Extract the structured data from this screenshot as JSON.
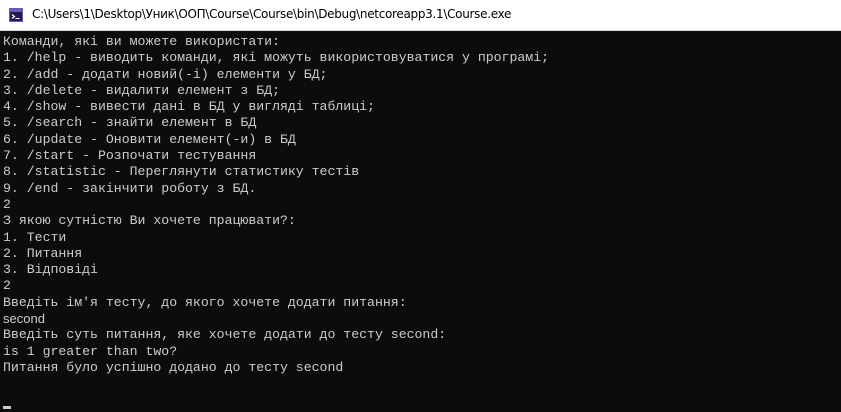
{
  "window": {
    "title": "C:\\Users\\1\\Desktop\\Уник\\ООП\\Course\\Course\\bin\\Debug\\netcoreapp3.1\\Course.exe",
    "icon": "console-app-icon",
    "background_color": "#0c0c0c",
    "text_color": "#cccccc"
  },
  "console": {
    "lines": [
      {
        "text": "Команди, які ви можете використати:",
        "font": "mono"
      },
      {
        "text": "1. /help - виводить команди, які можуть використовуватися у програмі;",
        "font": "mono"
      },
      {
        "text": "2. /add - додати новий(-і) елементи у БД;",
        "font": "mono"
      },
      {
        "text": "3. /delete - видалити елемент з БД;",
        "font": "mono"
      },
      {
        "text": "4. /show - вивести дані в БД у вигляді таблиці;",
        "font": "mono"
      },
      {
        "text": "5. /search - знайти елемент в БД",
        "font": "mono"
      },
      {
        "text": "6. /update - Оновити елемент(-и) в БД",
        "font": "mono"
      },
      {
        "text": "7. /start - Розпочати тестування",
        "font": "mono"
      },
      {
        "text": "8. /statistic - Переглянути статистику тестів",
        "font": "mono"
      },
      {
        "text": "9. /end - закінчити роботу з БД.",
        "font": "mono"
      },
      {
        "text": "2",
        "font": "mono"
      },
      {
        "text": "З якою сутністю Ви хочете працювати?:",
        "font": "mono"
      },
      {
        "text": "1. Тести",
        "font": "mono"
      },
      {
        "text": "2. Питання",
        "font": "mono"
      },
      {
        "text": "3. Відповіді",
        "font": "mono"
      },
      {
        "text": "2",
        "font": "mono"
      },
      {
        "text": "Введіть ім'я тесту, до якого хочете додати питання:",
        "font": "mono"
      },
      {
        "text": "second",
        "font": "sans"
      },
      {
        "text": "Введіть суть питання, яке хочете додати до тесту second:",
        "font": "mono"
      },
      {
        "text": "is 1 greater than two?",
        "font": "mono"
      },
      {
        "text": "Питання було успішно додано до тесту second",
        "font": "mono"
      }
    ]
  }
}
